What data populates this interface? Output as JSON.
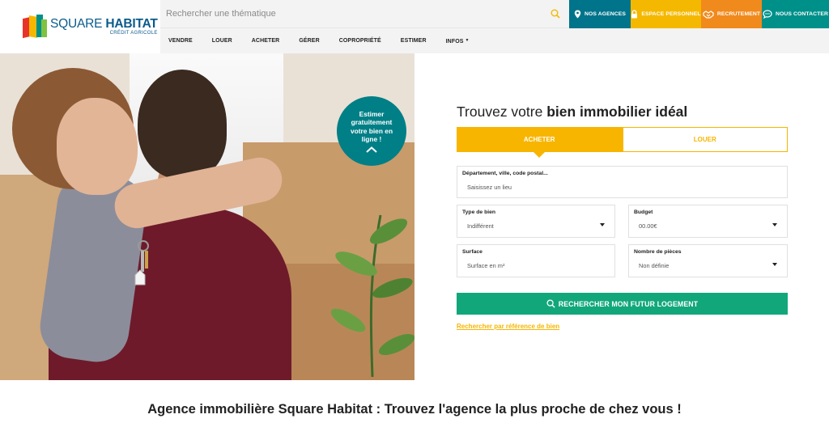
{
  "brand": {
    "name_light": "SQUARE ",
    "name_bold": "HABITAT",
    "tagline": "CRÉDIT AGRICOLE"
  },
  "search": {
    "placeholder": "Rechercher une thématique"
  },
  "quick_links": [
    {
      "label": "NOS AGENCES",
      "icon": "map-pin-icon",
      "color": "#00748a"
    },
    {
      "label": "ESPACE PERSONNEL",
      "icon": "lock-icon",
      "color": "#f5b800"
    },
    {
      "label": "RECRUTEMENT",
      "icon": "handshake-icon",
      "color": "#f18a1c"
    },
    {
      "label": "NOUS CONTACTER",
      "icon": "chat-bubble-icon",
      "color": "#00908a"
    }
  ],
  "nav": {
    "items": [
      "VENDRE",
      "LOUER",
      "ACHETER",
      "GÉRER",
      "COPROPRIÉTÉ",
      "ESTIMER",
      "INFOS"
    ]
  },
  "hero": {
    "image": "couple-hugging-with-keys-photo",
    "estimate_label": "Estimer gratuitement votre bien en ligne !"
  },
  "search_panel": {
    "title_regular": "Trouvez votre ",
    "title_bold": "bien immobilier idéal",
    "tabs": [
      {
        "label": "ACHETER",
        "active": true
      },
      {
        "label": "LOUER",
        "active": false
      }
    ],
    "location": {
      "label": "Département, ville, code postal...",
      "placeholder": "Saisissez un lieu"
    },
    "property_type": {
      "label": "Type de bien",
      "value": "Indifférent"
    },
    "budget": {
      "label": "Budget",
      "value": "00.00€"
    },
    "surface": {
      "label": "Surface",
      "placeholder": "Surface en m²"
    },
    "rooms": {
      "label": "Nombre de pièces",
      "value": "Non définie"
    },
    "submit_label": "RECHERCHER MON FUTUR LOGEMENT",
    "reference_link": "Rechercher par référence de bien"
  },
  "agency_section": {
    "heading": "Agence immobilière Square Habitat : Trouvez l'agence la plus proche de chez vous !"
  },
  "colors": {
    "accent_yellow": "#f7b500",
    "accent_green": "#12a77a",
    "brand_teal": "#007f86",
    "brand_blue": "#0a5b8c"
  }
}
